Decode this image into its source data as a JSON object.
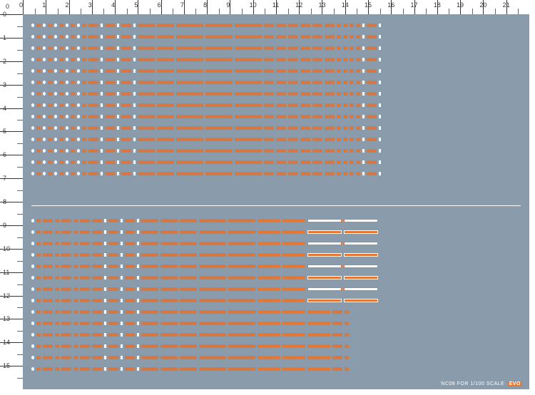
{
  "ruler": {
    "h_ticks": [
      "0",
      "1",
      "2",
      "3",
      "4",
      "5",
      "6",
      "7",
      "8",
      "9",
      "10",
      "11",
      "12",
      "13",
      "14",
      "15",
      "16",
      "17",
      "18",
      "19",
      "20",
      "21"
    ],
    "v_ticks": [
      "0",
      "1",
      "2",
      "3",
      "4",
      "5",
      "6",
      "7",
      "8",
      "9",
      "10",
      "11",
      "12",
      "13",
      "14",
      "15"
    ],
    "corner": "0"
  },
  "decal_sheet": {
    "primary_color": "#d67843",
    "accent_color": "#ffffff",
    "background": "#8a9bab",
    "top_rows": 14,
    "bottom_rows": 14,
    "columns_approx": 22
  },
  "footer": {
    "text": "NC08 FOR 1/100 SCALE",
    "brand": "EVO"
  }
}
